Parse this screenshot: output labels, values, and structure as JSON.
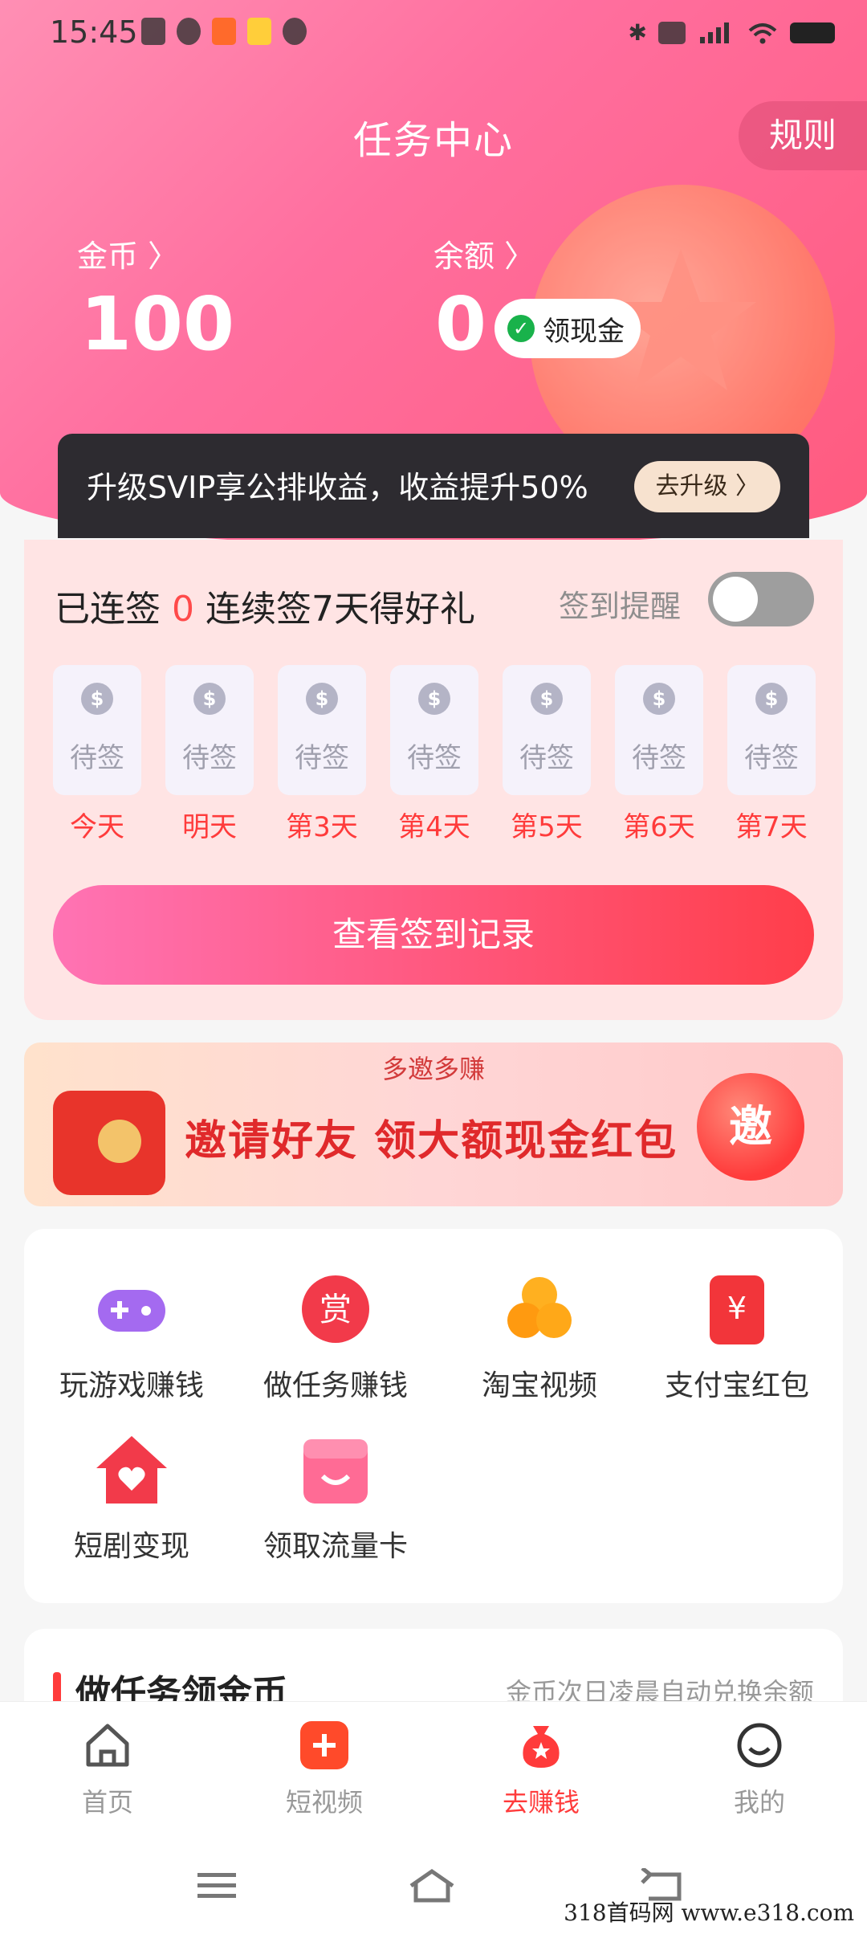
{
  "status_bar": {
    "time": "15:45"
  },
  "header": {
    "title": "任务中心",
    "rules_label": "规则",
    "gold_label": "金币 〉",
    "gold_value": "100",
    "balance_label": "余额 〉",
    "balance_value": "0",
    "cash_button": "领现金"
  },
  "svip": {
    "text": "升级SVIP享公排收益，收益提升50%",
    "button": "去升级 〉"
  },
  "sign_in": {
    "streak_prefix": "已连签",
    "streak_count": "0",
    "streak_suffix": "连续签7天得好礼",
    "reminder_label": "签到提醒",
    "reminder_on": false,
    "days": [
      {
        "status": "待签",
        "label": "今天"
      },
      {
        "status": "待签",
        "label": "明天"
      },
      {
        "status": "待签",
        "label": "第3天"
      },
      {
        "status": "待签",
        "label": "第4天"
      },
      {
        "status": "待签",
        "label": "第5天"
      },
      {
        "status": "待签",
        "label": "第6天"
      },
      {
        "status": "待签",
        "label": "第7天"
      }
    ],
    "coin_symbol": "$",
    "records_button": "查看签到记录"
  },
  "invite_banner": {
    "top_text": "多邀多赚",
    "main_text": "邀请好友 领大额现金红包",
    "badge": "邀"
  },
  "features": [
    {
      "label": "玩游戏赚钱",
      "icon": "gamepad-icon"
    },
    {
      "label": "做任务赚钱",
      "icon": "reward-icon",
      "glyph": "赏"
    },
    {
      "label": "淘宝视频",
      "icon": "taobao-icon"
    },
    {
      "label": "支付宝红包",
      "icon": "red-envelope-icon",
      "glyph": "¥"
    },
    {
      "label": "短剧变现",
      "icon": "heart-house-icon"
    },
    {
      "label": "领取流量卡",
      "icon": "shop-icon"
    }
  ],
  "tasks": {
    "title": "做任务领金币",
    "subtitle": "金币次日凌晨自动兑换余额"
  },
  "bottom_nav": [
    {
      "label": "首页",
      "icon": "home-icon"
    },
    {
      "label": "短视频",
      "icon": "short-video-icon"
    },
    {
      "label": "去赚钱",
      "icon": "money-bag-icon",
      "active": true
    },
    {
      "label": "我的",
      "icon": "profile-icon"
    }
  ],
  "watermark": "318首码网 www.e318.com",
  "colors": {
    "accent": "#ff3b3b",
    "header": "#ff6f9f",
    "sign_bg": "#ffe4e4"
  }
}
